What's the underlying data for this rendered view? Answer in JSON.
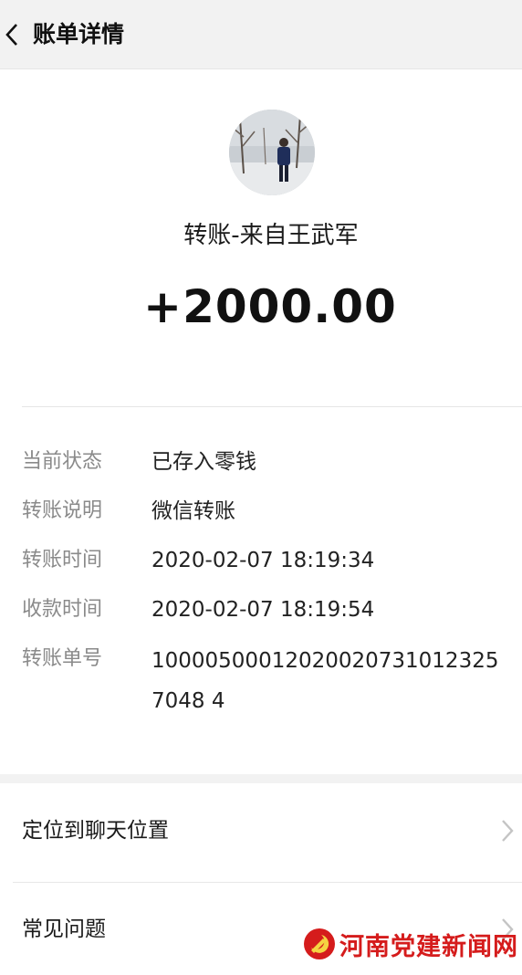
{
  "header": {
    "title": "账单详情",
    "back_icon": "chevron-left-icon"
  },
  "transfer": {
    "title": "转账-来自王武军",
    "amount": "+2000.00"
  },
  "details": [
    {
      "label": "当前状态",
      "value": "已存入零钱"
    },
    {
      "label": "转账说明",
      "value": "微信转账"
    },
    {
      "label": "转账时间",
      "value": "2020-02-07 18:19:34"
    },
    {
      "label": "收款时间",
      "value": "2020-02-07 18:19:54"
    },
    {
      "label": "转账单号",
      "value": "100005000120200207310123257048 4"
    }
  ],
  "menu": {
    "locate_chat": "定位到聊天位置",
    "faq": "常见问题"
  },
  "watermark": {
    "text": "河南党建新闻网"
  },
  "colors": {
    "header_bg": "#f2f2f2",
    "label_gray": "#8a8a8a",
    "watermark_red": "#d51c1c"
  }
}
